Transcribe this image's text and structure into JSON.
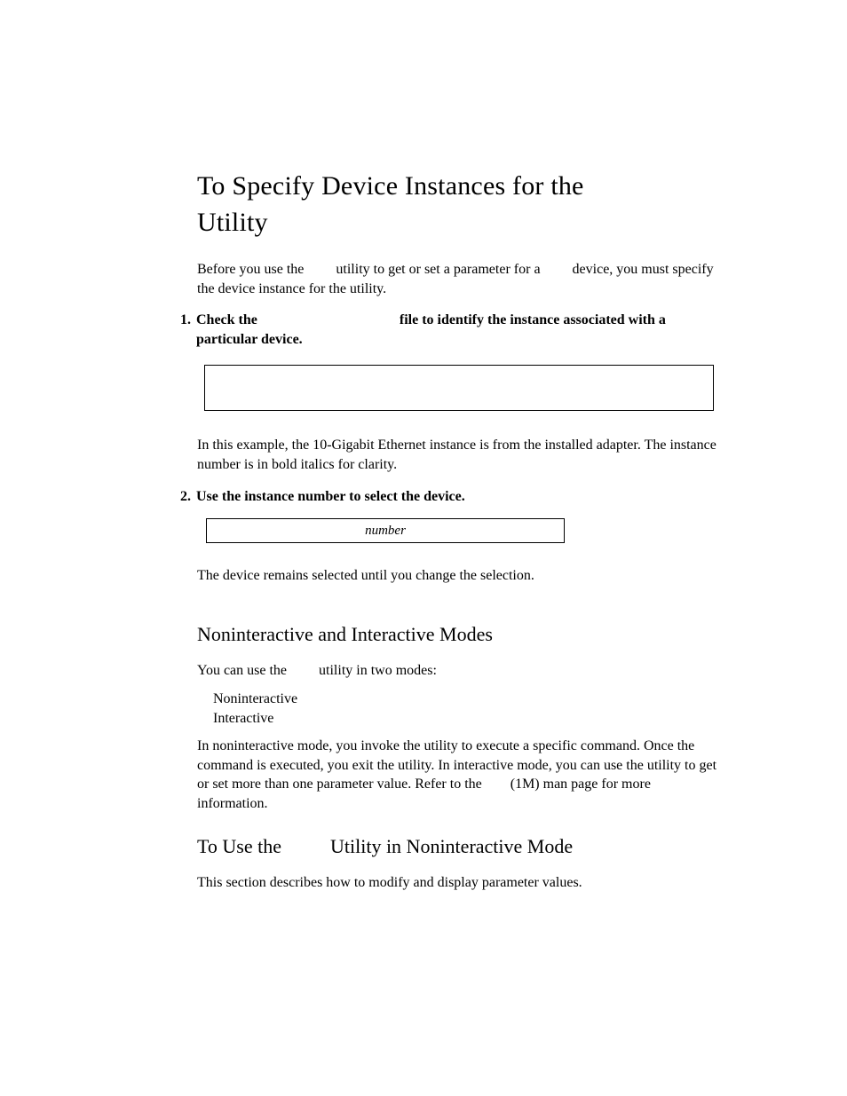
{
  "h1_part1": "To Specify Device Instances for the ",
  "h1_part2": " Utility",
  "intro_before": "Before you use the ",
  "intro_mid": " utility to get or set a parameter for a ",
  "intro_after": " device, you must specify the device instance for the utility.",
  "step1_num": "1.",
  "step1_a": "Check the ",
  "step1_b": " file to identify the instance associated with a particular device.",
  "example_text": "In this example, the 10-Gigabit Ethernet instance is from the installed adapter. The instance number is in bold italics for clarity.",
  "step2_num": "2.",
  "step2_text": "Use the instance number to select the device.",
  "codebox_small_text": "number",
  "selected_text": "The device remains selected until you change the selection.",
  "h2_modes": "Noninteractive and Interactive Modes",
  "modes_intro_before": "You can use the ",
  "modes_intro_after": " utility in two modes:",
  "mode_item1": "Noninteractive",
  "mode_item2": "Interactive",
  "modes_para_before": "In noninteractive mode, you invoke the utility to execute a specific command. Once the command is executed, you exit the utility. In interactive mode, you can use the utility to get or set more than one parameter value. Refer to the ",
  "modes_para_after": "(1M) man page for more information.",
  "h2_use_before": "To Use the ",
  "h2_use_after": " Utility in Noninteractive Mode",
  "use_para": "This section describes how to modify and display parameter values.",
  "footer_text": ""
}
